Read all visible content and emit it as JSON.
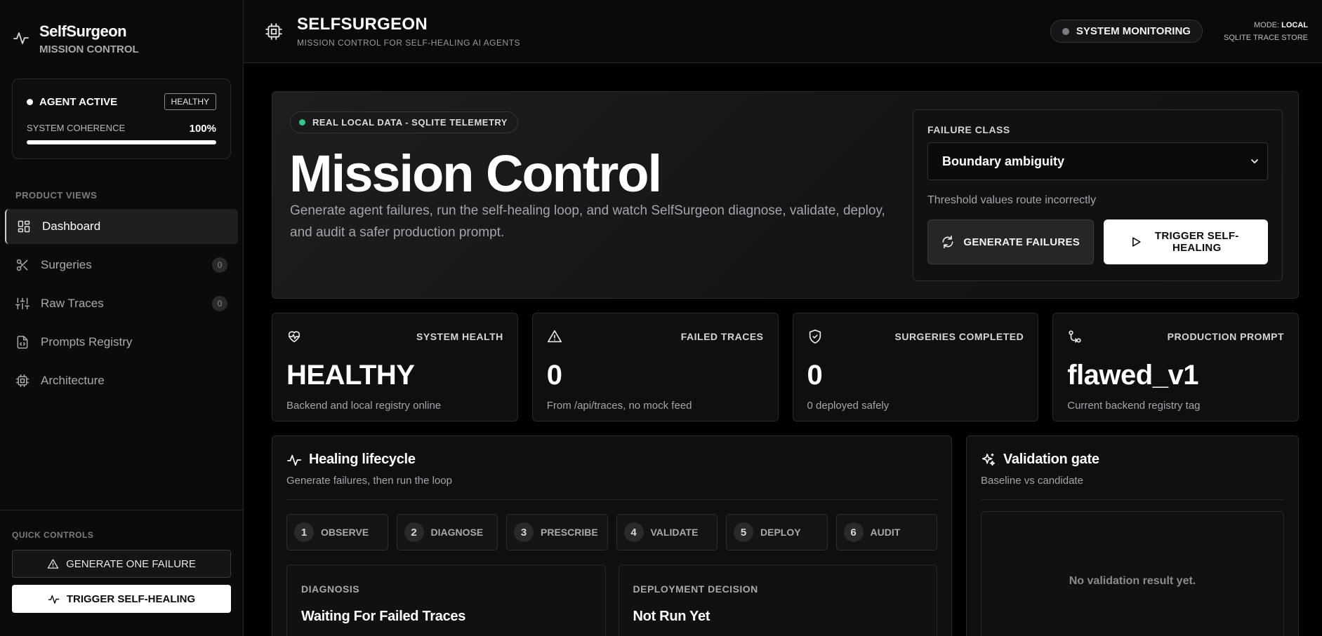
{
  "sidebar": {
    "brand_title": "SelfSurgeon",
    "brand_subtitle": "MISSION CONTROL",
    "agent_status": "AGENT ACTIVE",
    "health_badge": "HEALTHY",
    "coherence_label": "SYSTEM COHERENCE",
    "coherence_value": "100%",
    "coherence_fraction": 1.0,
    "section_label": "PRODUCT VIEWS",
    "items": [
      {
        "label": "Dashboard",
        "icon": "dashboard-icon",
        "active": true
      },
      {
        "label": "Surgeries",
        "icon": "scissors-icon",
        "count": "0"
      },
      {
        "label": "Raw Traces",
        "icon": "sliders-icon",
        "count": "0"
      },
      {
        "label": "Prompts Registry",
        "icon": "file-code-icon"
      },
      {
        "label": "Architecture",
        "icon": "cpu-icon"
      }
    ],
    "quick_label": "QUICK CONTROLS",
    "quick_generate": "GENERATE ONE FAILURE",
    "quick_trigger": "TRIGGER SELF-HEALING"
  },
  "topbar": {
    "title": "SELFSURGEON",
    "subtitle": "MISSION CONTROL FOR SELF-HEALING AI AGENTS",
    "monitor_label": "SYSTEM MONITORING",
    "mode_label": "MODE:",
    "mode_value": "LOCAL",
    "store_label": "SQLITE TRACE STORE"
  },
  "hero": {
    "pill": "REAL LOCAL DATA - SQLITE TELEMETRY",
    "title": "Mission Control",
    "description": "Generate agent failures, run the self-healing loop, and watch SelfSurgeon diagnose, validate, deploy, and audit a safer production prompt.",
    "failure_class_label": "FAILURE CLASS",
    "failure_class_value": "Boundary ambiguity",
    "failure_hint": "Threshold values route incorrectly",
    "generate_button": "GENERATE FAILURES",
    "trigger_button": "TRIGGER SELF-HEALING"
  },
  "stats": [
    {
      "label": "SYSTEM HEALTH",
      "value": "HEALTHY",
      "desc": "Backend and local registry online",
      "icon": "heart-pulse-icon"
    },
    {
      "label": "FAILED TRACES",
      "value": "0",
      "desc": "From /api/traces, no mock feed",
      "icon": "warning-icon"
    },
    {
      "label": "SURGERIES COMPLETED",
      "value": "0",
      "desc": "0 deployed safely",
      "icon": "shield-check-icon"
    },
    {
      "label": "PRODUCTION PROMPT",
      "value": "flawed_v1",
      "desc": "Current backend registry tag",
      "icon": "git-compare-icon"
    }
  ],
  "lifecycle": {
    "title": "Healing lifecycle",
    "subtitle": "Generate failures, then run the loop",
    "steps": [
      {
        "num": "1",
        "label": "OBSERVE"
      },
      {
        "num": "2",
        "label": "DIAGNOSE"
      },
      {
        "num": "3",
        "label": "PRESCRIBE"
      },
      {
        "num": "4",
        "label": "VALIDATE"
      },
      {
        "num": "5",
        "label": "DEPLOY"
      },
      {
        "num": "6",
        "label": "AUDIT"
      }
    ],
    "diagnosis_label": "DIAGNOSIS",
    "diagnosis_value": "Waiting For Failed Traces",
    "deploy_label": "DEPLOYMENT DECISION",
    "deploy_value": "Not Run Yet"
  },
  "validation": {
    "title": "Validation gate",
    "subtitle": "Baseline vs candidate",
    "empty": "No validation result yet."
  }
}
